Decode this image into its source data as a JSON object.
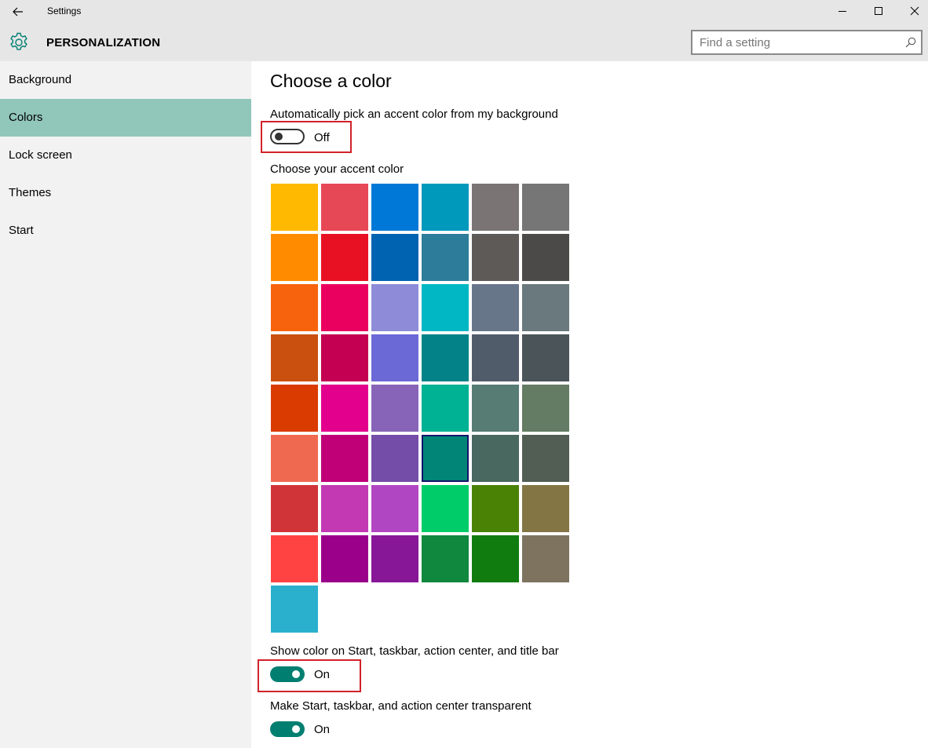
{
  "window": {
    "title": "Settings"
  },
  "header": {
    "title": "PERSONALIZATION"
  },
  "search": {
    "placeholder": "Find a setting"
  },
  "sidebar": {
    "items": [
      {
        "label": "Background",
        "active": false
      },
      {
        "label": "Colors",
        "active": true
      },
      {
        "label": "Lock screen",
        "active": false
      },
      {
        "label": "Themes",
        "active": false
      },
      {
        "label": "Start",
        "active": false
      }
    ]
  },
  "main": {
    "heading": "Choose a color",
    "auto_accent": {
      "label": "Automatically pick an accent color from my background",
      "state": "Off"
    },
    "accent_label": "Choose your accent color",
    "selected_color": "#008577",
    "colors": [
      "#FFB900",
      "#E74856",
      "#0078D7",
      "#0099BC",
      "#7A7574",
      "#767676",
      "#FF8C00",
      "#E81123",
      "#0063B1",
      "#2D7D9A",
      "#5D5A58",
      "#4C4A48",
      "#F7630C",
      "#EA005E",
      "#8E8CD8",
      "#00B7C3",
      "#68768A",
      "#69797E",
      "#CA5010",
      "#C30052",
      "#6B69D6",
      "#038387",
      "#515C6B",
      "#4A5459",
      "#DA3B01",
      "#E3008C",
      "#8764B8",
      "#00B294",
      "#567C73",
      "#647C64",
      "#EF6950",
      "#BF0077",
      "#744DA9",
      "#008577",
      "#486860",
      "#525E54",
      "#D13438",
      "#C239B3",
      "#B146C2",
      "#00CC6A",
      "#498205",
      "#847545",
      "#FF4343",
      "#9A0089",
      "#881798",
      "#10893E",
      "#107C10",
      "#7E735F",
      "#2AB0CD"
    ],
    "show_color": {
      "label": "Show color on Start, taskbar, action center, and title bar",
      "state": "On"
    },
    "transparent": {
      "label": "Make Start, taskbar, and action center transparent",
      "state": "On"
    }
  },
  "theme": {
    "accent": "#007F71",
    "highlight_box": "#D1222A",
    "selected_nav": "#91C6BB"
  }
}
